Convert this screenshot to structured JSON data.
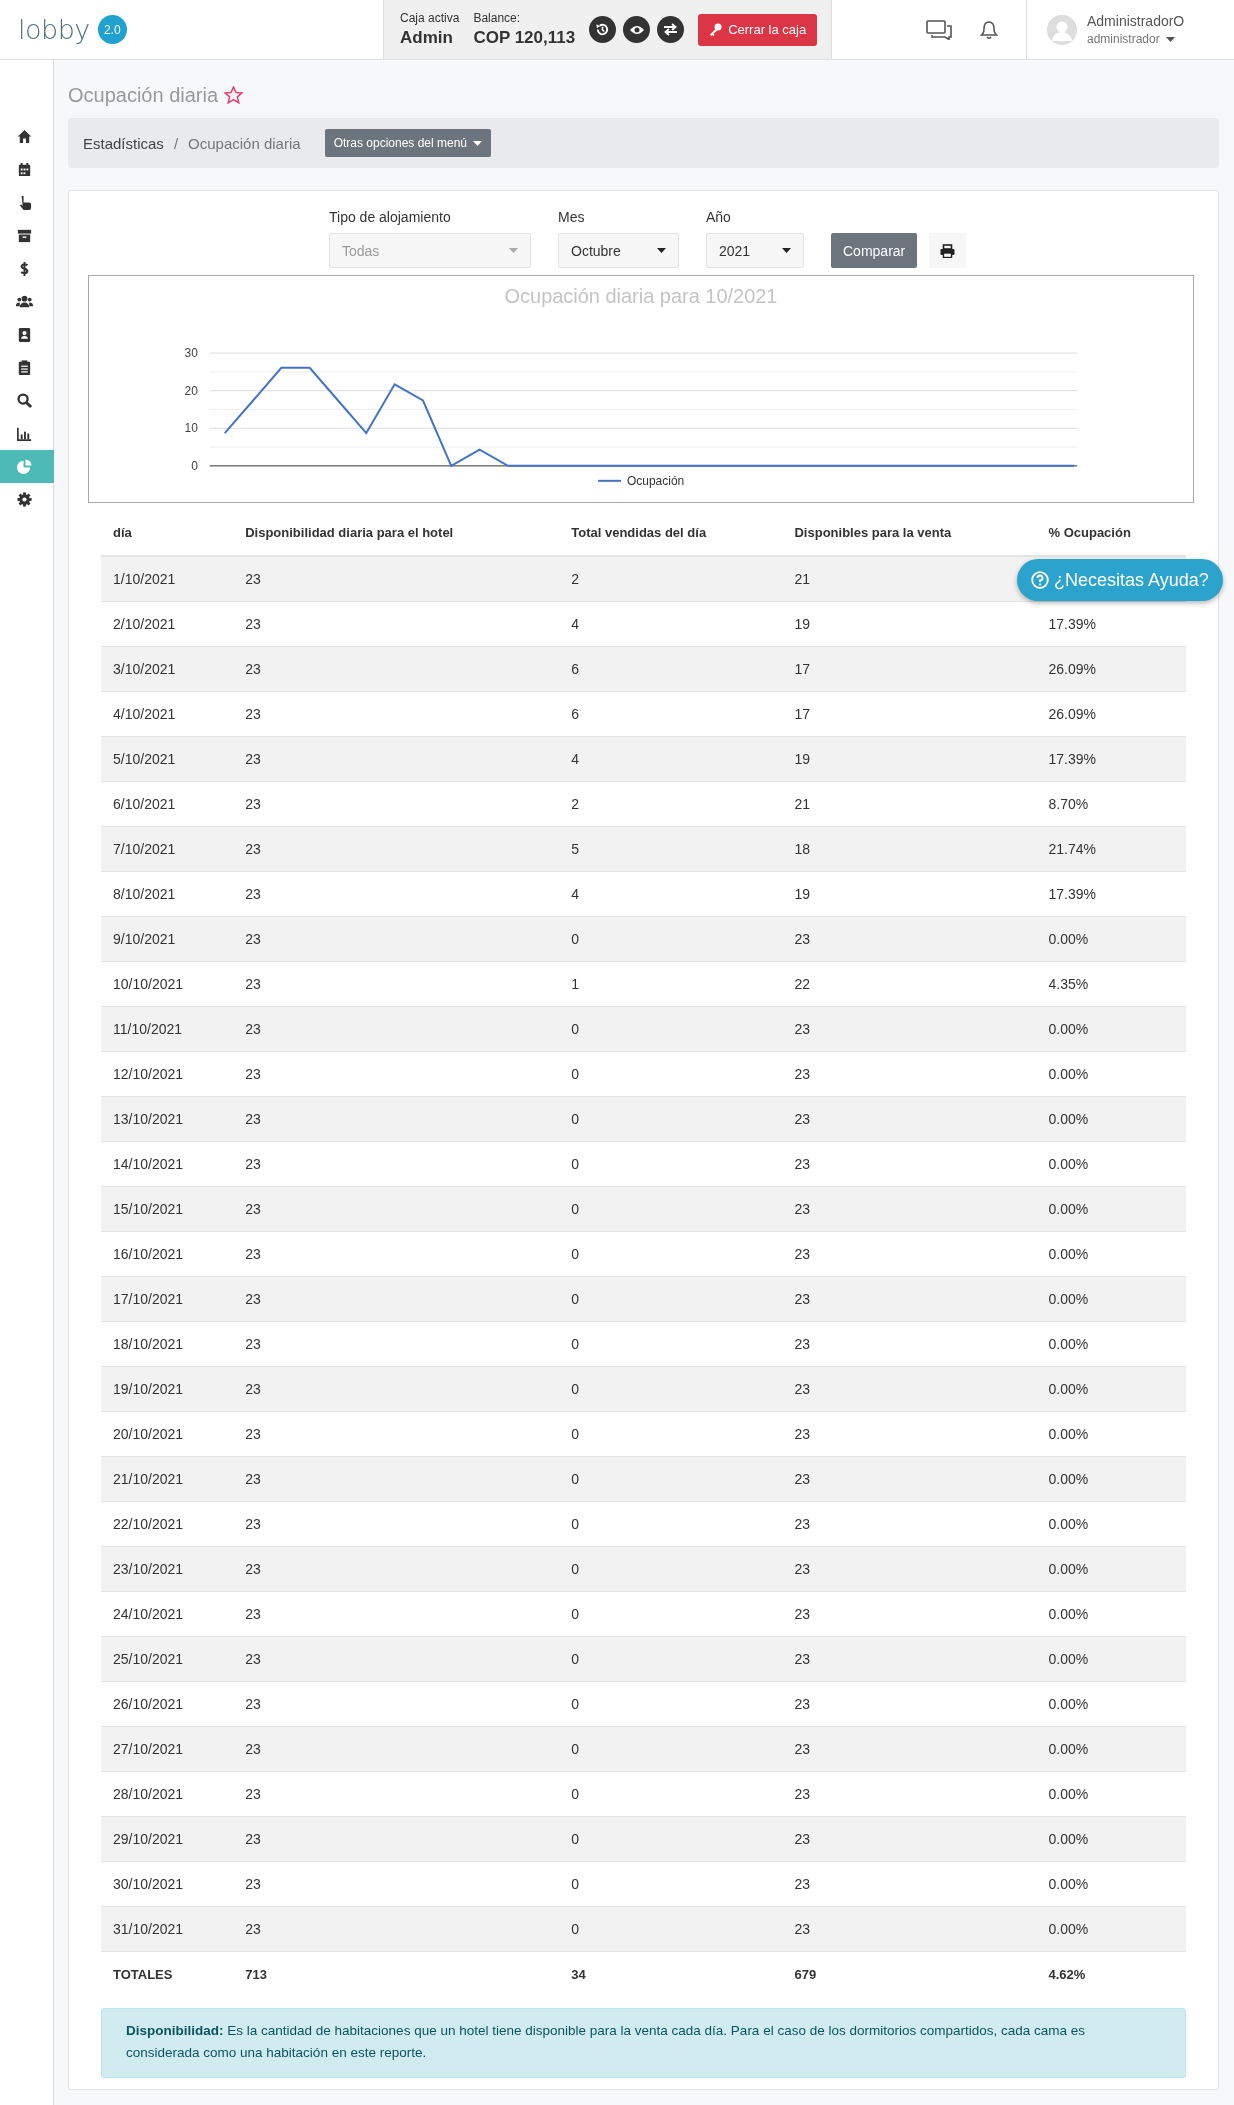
{
  "header": {
    "logo": "lobby",
    "version": "2.0",
    "cash_label": "Caja activa",
    "cash_value": "Admin",
    "balance_label": "Balance:",
    "balance_value": "COP 120,113",
    "close_button": "Cerrar la caja",
    "user_name": "AdministradorO",
    "user_role": "administrador"
  },
  "sidebar": {
    "items": [
      {
        "selected": false
      },
      {
        "selected": false
      },
      {
        "selected": false
      },
      {
        "selected": false
      },
      {
        "selected": false
      },
      {
        "selected": false
      },
      {
        "selected": false
      },
      {
        "selected": false
      },
      {
        "selected": false
      },
      {
        "selected": false
      },
      {
        "selected": true
      },
      {
        "selected": false
      }
    ]
  },
  "page_title": "Ocupación diaria",
  "favorite": false,
  "breadcrumb": [
    "Estadísticas",
    "Ocupación diaria"
  ],
  "breadcrumb_separator": "/",
  "menu_button": "Otras opciones del menú",
  "filters": [
    {
      "label": "Tipo de alojamiento",
      "value": "Todas",
      "disabled": true
    },
    {
      "label": "Mes",
      "value": "Octubre",
      "disabled": false
    },
    {
      "label": "Año",
      "value": "2021",
      "disabled": false
    }
  ],
  "compare_button": "Comparar",
  "chart": {
    "chart_data": {
      "type": "line",
      "title": "Ocupación diaria para 10/2021",
      "ylim": [
        0,
        30
      ],
      "yticks": [
        0,
        10,
        20,
        30
      ],
      "series": [
        {
          "name": "Ocupación",
          "color": "#4472c4",
          "values": [
            8.7,
            17.4,
            26.1,
            26.1,
            17.4,
            8.7,
            21.7,
            17.4,
            0,
            4.3,
            0,
            0,
            0,
            0,
            0,
            0,
            0,
            0,
            0,
            0,
            0,
            0,
            0,
            0,
            0,
            0,
            0,
            0,
            0,
            0,
            0
          ]
        }
      ]
    }
  },
  "table": {
    "columns": [
      "día",
      "Disponibilidad diaria para el hotel",
      "Total vendidas del día",
      "Disponibles para la venta",
      "% Ocupación"
    ],
    "rows": [
      {
        "cells": [
          "1/10/2021",
          "23",
          "2",
          "21"
        ]
      },
      {
        "cells": [
          "2/10/2021",
          "23",
          "4",
          "19",
          "17.39%"
        ]
      },
      {
        "cells": [
          "3/10/2021",
          "23",
          "6",
          "17",
          "26.09%"
        ]
      },
      {
        "cells": [
          "4/10/2021",
          "23",
          "6",
          "17",
          "26.09%"
        ]
      },
      {
        "cells": [
          "5/10/2021",
          "23",
          "4",
          "19",
          "17.39%"
        ]
      },
      {
        "cells": [
          "6/10/2021",
          "23",
          "2",
          "21",
          "8.70%"
        ]
      },
      {
        "cells": [
          "7/10/2021",
          "23",
          "5",
          "18",
          "21.74%"
        ]
      },
      {
        "cells": [
          "8/10/2021",
          "23",
          "4",
          "19",
          "17.39%"
        ]
      },
      {
        "cells": [
          "9/10/2021",
          "23",
          "0",
          "23",
          "0.00%"
        ]
      },
      {
        "cells": [
          "10/10/2021",
          "23",
          "1",
          "22",
          "4.35%"
        ]
      },
      {
        "cells": [
          "11/10/2021",
          "23",
          "0",
          "23",
          "0.00%"
        ]
      },
      {
        "cells": [
          "12/10/2021",
          "23",
          "0",
          "23",
          "0.00%"
        ]
      },
      {
        "cells": [
          "13/10/2021",
          "23",
          "0",
          "23",
          "0.00%"
        ]
      },
      {
        "cells": [
          "14/10/2021",
          "23",
          "0",
          "23",
          "0.00%"
        ]
      },
      {
        "cells": [
          "15/10/2021",
          "23",
          "0",
          "23",
          "0.00%"
        ]
      },
      {
        "cells": [
          "16/10/2021",
          "23",
          "0",
          "23",
          "0.00%"
        ]
      },
      {
        "cells": [
          "17/10/2021",
          "23",
          "0",
          "23",
          "0.00%"
        ]
      },
      {
        "cells": [
          "18/10/2021",
          "23",
          "0",
          "23",
          "0.00%"
        ]
      },
      {
        "cells": [
          "19/10/2021",
          "23",
          "0",
          "23",
          "0.00%"
        ]
      },
      {
        "cells": [
          "20/10/2021",
          "23",
          "0",
          "23",
          "0.00%"
        ]
      },
      {
        "cells": [
          "21/10/2021",
          "23",
          "0",
          "23",
          "0.00%"
        ]
      },
      {
        "cells": [
          "22/10/2021",
          "23",
          "0",
          "23",
          "0.00%"
        ]
      },
      {
        "cells": [
          "23/10/2021",
          "23",
          "0",
          "23",
          "0.00%"
        ]
      },
      {
        "cells": [
          "24/10/2021",
          "23",
          "0",
          "23",
          "0.00%"
        ]
      },
      {
        "cells": [
          "25/10/2021",
          "23",
          "0",
          "23",
          "0.00%"
        ]
      },
      {
        "cells": [
          "26/10/2021",
          "23",
          "0",
          "23",
          "0.00%"
        ]
      },
      {
        "cells": [
          "27/10/2021",
          "23",
          "0",
          "23",
          "0.00%"
        ]
      },
      {
        "cells": [
          "28/10/2021",
          "23",
          "0",
          "23",
          "0.00%"
        ]
      },
      {
        "cells": [
          "29/10/2021",
          "23",
          "0",
          "23",
          "0.00%"
        ]
      },
      {
        "cells": [
          "30/10/2021",
          "23",
          "0",
          "23",
          "0.00%"
        ]
      },
      {
        "cells": [
          "31/10/2021",
          "23",
          "0",
          "23",
          "0.00%"
        ]
      }
    ],
    "totals": [
      "TOTALES",
      "713",
      "34",
      "679",
      "4.62%"
    ]
  },
  "note": "**Disponibilidad:** Es la cantidad de habitaciones que un hotel tiene disponible para la venta cada día. Para el caso de los dormitorios compartidos, cada cama es considerada como una habitación en este reporte.",
  "help_button": "¿Necesitas Ayuda?"
}
